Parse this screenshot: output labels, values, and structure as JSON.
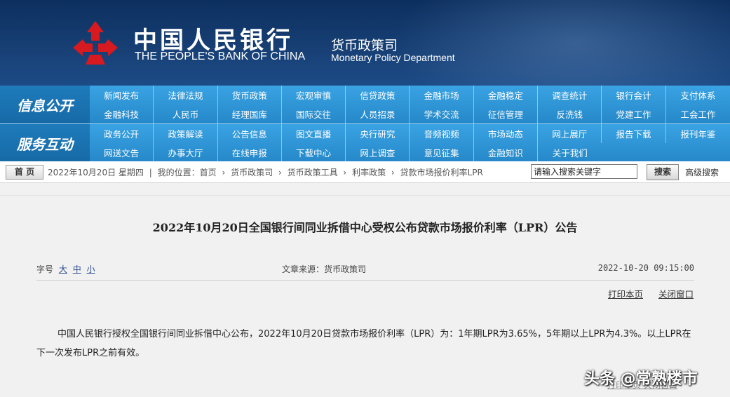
{
  "header": {
    "bank_cn": "中国人民银行",
    "bank_en": "THE PEOPLE'S BANK OF CHINA",
    "dept_cn": "货币政策司",
    "dept_en": "Monetary Policy Department"
  },
  "nav": {
    "section1_label": "信息公开",
    "section1_items": [
      "新闻发布",
      "法律法规",
      "货币政策",
      "宏观审慎",
      "信贷政策",
      "金融市场",
      "金融稳定",
      "调查统计",
      "银行会计",
      "支付体系",
      "金融科技",
      "人民币",
      "经理国库",
      "国际交往",
      "人员招录",
      "学术交流",
      "征信管理",
      "反洗钱",
      "党建工作",
      "工会工作"
    ],
    "section2_label": "服务互动",
    "section2_items": [
      "政务公开",
      "政策解读",
      "公告信息",
      "图文直播",
      "央行研究",
      "音频视频",
      "市场动态",
      "网上展厅",
      "报告下载",
      "报刊年鉴",
      "网送文告",
      "办事大厅",
      "在线申报",
      "下载中心",
      "网上调查",
      "意见征集",
      "金融知识",
      "关于我们"
    ]
  },
  "crumb": {
    "home": "首 页",
    "date": "2022年10月20日  星期四",
    "location_label": "我的位置：首页",
    "items": [
      "货币政策司",
      "货币政策工具",
      "利率政策",
      "贷款市场报价利率LPR"
    ],
    "search_placeholder": "请输入搜索关键字",
    "search_button": "搜索",
    "advanced": "高级搜索"
  },
  "article": {
    "title": "2022年10月20日全国银行间同业拆借中心受权公布贷款市场报价利率（LPR）公告",
    "font_label": "字号",
    "font_large": "大",
    "font_medium": "中",
    "font_small": "小",
    "source": "文章来源：货币政策司",
    "datetime": "2022-10-20  09:15:00",
    "print": "打印本页",
    "close": "关闭窗口",
    "body": "中国人民银行授权全国银行间同业拆借中心公布，2022年10月20日贷款市场报价利率（LPR）为：1年期LPR为3.65%，5年期以上LPR为4.3%。以上LPR在下一次发布LPR之前有效。"
  },
  "watermark": "头条 @常熟楼市",
  "footer_links": "打印本页  关闭窗口"
}
